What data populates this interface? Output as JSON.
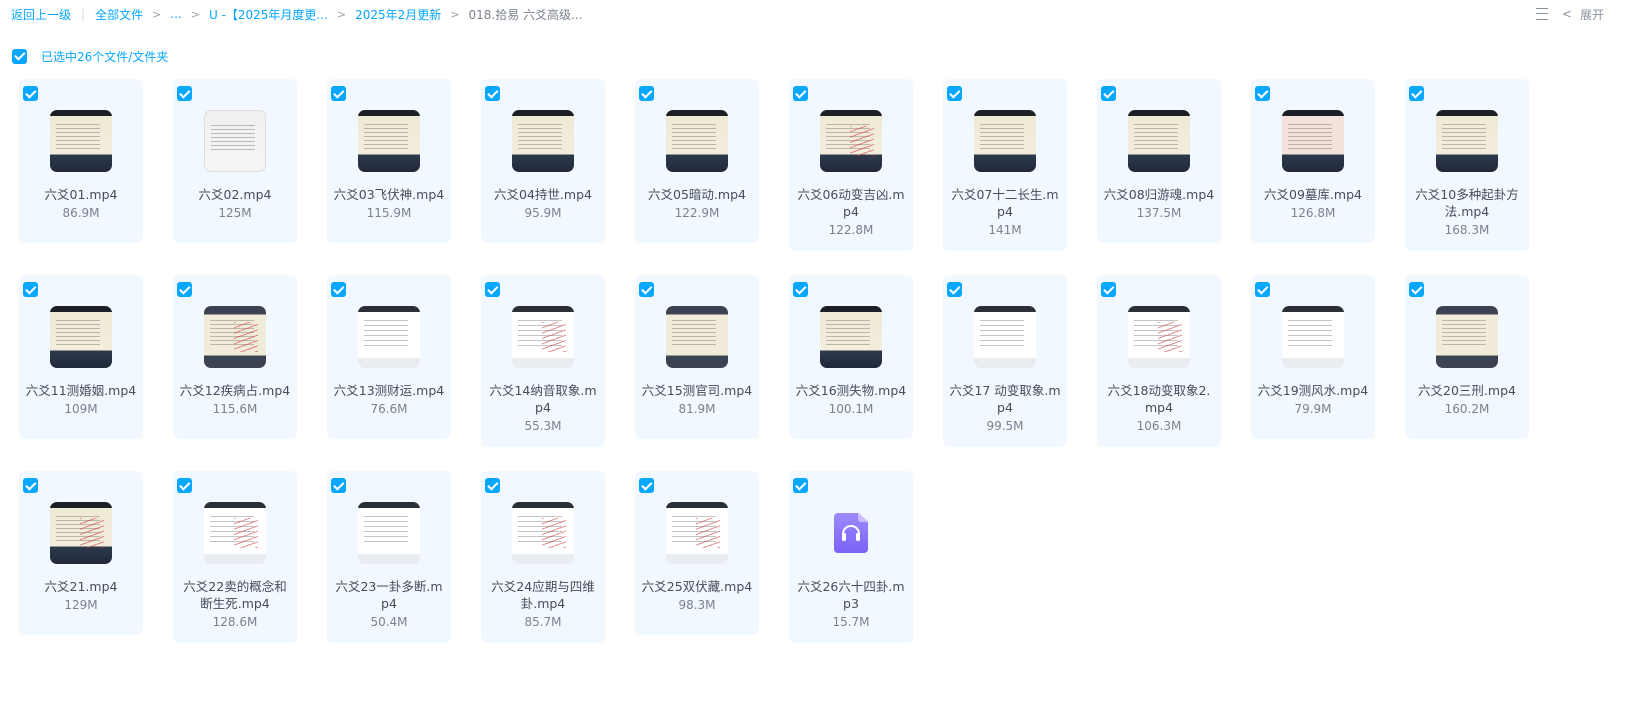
{
  "breadcrumb": {
    "back": "返回上一级",
    "all_files": "全部文件",
    "ellipsis": "...",
    "folder1": "U -【2025年月度更...",
    "folder2": "2025年2月更新",
    "current": "018.拾易 六爻高级..."
  },
  "toolbar": {
    "expand_label": "展开"
  },
  "selection": {
    "label": "已选中26个文件/文件夹"
  },
  "files": [
    {
      "name": "六爻01.mp4",
      "size": "86.9M",
      "thumb": "video"
    },
    {
      "name": "六爻02.mp4",
      "size": "125M",
      "thumb": "video"
    },
    {
      "name": "六爻03飞伏神.mp4",
      "size": "115.9M",
      "thumb": "video"
    },
    {
      "name": "六爻04持世.mp4",
      "size": "95.9M",
      "thumb": "video"
    },
    {
      "name": "六爻05暗动.mp4",
      "size": "122.9M",
      "thumb": "video"
    },
    {
      "name": "六爻06动变吉凶.mp4",
      "size": "122.8M",
      "thumb": "video"
    },
    {
      "name": "六爻07十二长生.mp4",
      "size": "141M",
      "thumb": "video"
    },
    {
      "name": "六爻08归游魂.mp4",
      "size": "137.5M",
      "thumb": "video"
    },
    {
      "name": "六爻09墓库.mp4",
      "size": "126.8M",
      "thumb": "video"
    },
    {
      "name": "六爻10多种起卦方法.mp4",
      "size": "168.3M",
      "thumb": "video"
    },
    {
      "name": "六爻11测婚姻.mp4",
      "size": "109M",
      "thumb": "video"
    },
    {
      "name": "六爻12疾病占.mp4",
      "size": "115.6M",
      "thumb": "video"
    },
    {
      "name": "六爻13测财运.mp4",
      "size": "76.6M",
      "thumb": "video"
    },
    {
      "name": "六爻14纳音取象.mp4",
      "size": "55.3M",
      "thumb": "video"
    },
    {
      "name": "六爻15测官司.mp4",
      "size": "81.9M",
      "thumb": "video"
    },
    {
      "name": "六爻16测失物.mp4",
      "size": "100.1M",
      "thumb": "video"
    },
    {
      "name": "六爻17 动变取象.mp4",
      "size": "99.5M",
      "thumb": "video"
    },
    {
      "name": "六爻18动变取象2.mp4",
      "size": "106.3M",
      "thumb": "video"
    },
    {
      "name": "六爻19测风水.mp4",
      "size": "79.9M",
      "thumb": "video"
    },
    {
      "name": "六爻20三刑.mp4",
      "size": "160.2M",
      "thumb": "video"
    },
    {
      "name": "六爻21.mp4",
      "size": "129M",
      "thumb": "video"
    },
    {
      "name": "六爻22卖的概念和断生死.mp4",
      "size": "128.6M",
      "thumb": "video"
    },
    {
      "name": "六爻23一卦多断.mp4",
      "size": "50.4M",
      "thumb": "video"
    },
    {
      "name": "六爻24应期与四维卦.mp4",
      "size": "85.7M",
      "thumb": "video"
    },
    {
      "name": "六爻25双伏藏.mp4",
      "size": "98.3M",
      "thumb": "video"
    },
    {
      "name": "六爻26六十四卦.mp3",
      "size": "15.7M",
      "thumb": "audio"
    }
  ]
}
